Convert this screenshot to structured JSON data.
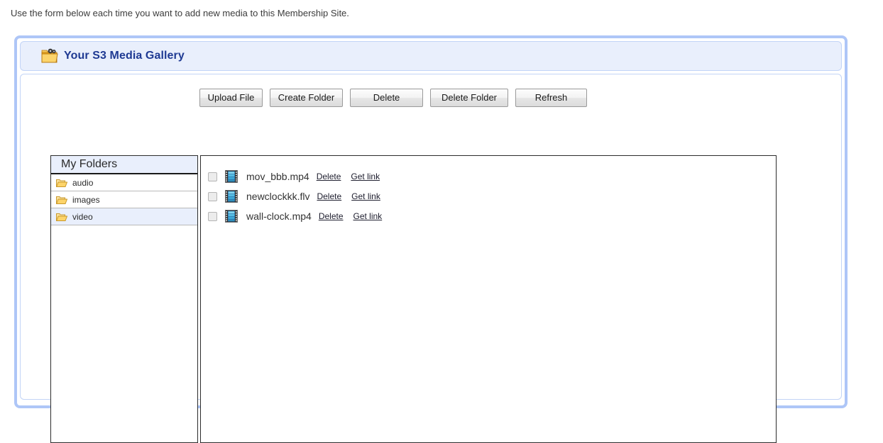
{
  "intro": {
    "text": "Use the form below each time you want to add new media to this Membership Site."
  },
  "header": {
    "title": "Your S3 Media Gallery",
    "icon": "media-folder-icon",
    "accent_color": "#1f3a93",
    "border_color": "#aec6f7",
    "background_color": "#e9effc"
  },
  "toolbar": {
    "buttons": [
      {
        "label": "Upload File"
      },
      {
        "label": "Create Folder"
      },
      {
        "label": "Delete"
      },
      {
        "label": "Delete Folder"
      },
      {
        "label": "Refresh"
      }
    ]
  },
  "folders_panel": {
    "heading": "My Folders",
    "items": [
      {
        "label": "audio",
        "icon": "open-folder-icon",
        "selected": false
      },
      {
        "label": "images",
        "icon": "open-folder-icon",
        "selected": false
      },
      {
        "label": "video",
        "icon": "open-folder-icon",
        "selected": true
      }
    ]
  },
  "files_panel": {
    "row_actions": {
      "delete": "Delete",
      "get_link": "Get link"
    },
    "files": [
      {
        "name": "mov_bbb.mp4",
        "icon": "film-strip-icon",
        "checked": false
      },
      {
        "name": "newclockkk.flv",
        "icon": "film-strip-icon",
        "checked": false
      },
      {
        "name": "wall-clock.mp4",
        "icon": "film-strip-icon",
        "checked": false
      }
    ]
  }
}
